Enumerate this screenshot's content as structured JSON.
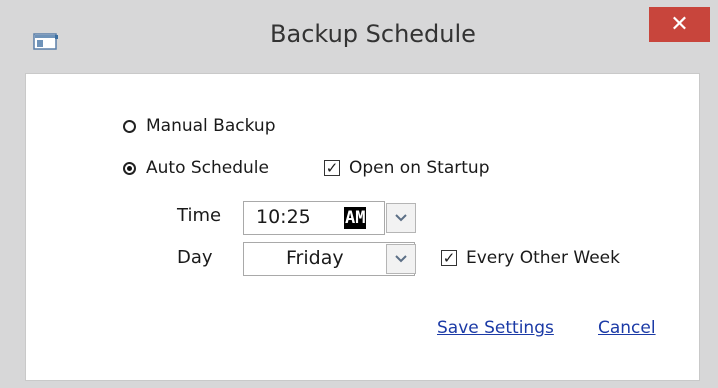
{
  "window": {
    "title": "Backup Schedule",
    "close_glyph": "✕"
  },
  "mode": {
    "manual_label": "Manual Backup",
    "auto_label": "Auto Schedule",
    "selected": "auto"
  },
  "open_on_startup": {
    "label": "Open on Startup",
    "checked": true,
    "check_glyph": "✓"
  },
  "time": {
    "label": "Time",
    "value": "10:25",
    "ampm": "AM"
  },
  "day": {
    "label": "Day",
    "value": "Friday"
  },
  "every_other_week": {
    "label": "Every Other Week",
    "checked": true,
    "check_glyph": "✓"
  },
  "actions": {
    "save_label": "Save Settings",
    "cancel_label": "Cancel"
  },
  "icons": {
    "app": "window-app-icon",
    "dropdown": "chevron-down-icon"
  },
  "colors": {
    "close_button": "#c8453c",
    "link": "#1b3aa6"
  }
}
